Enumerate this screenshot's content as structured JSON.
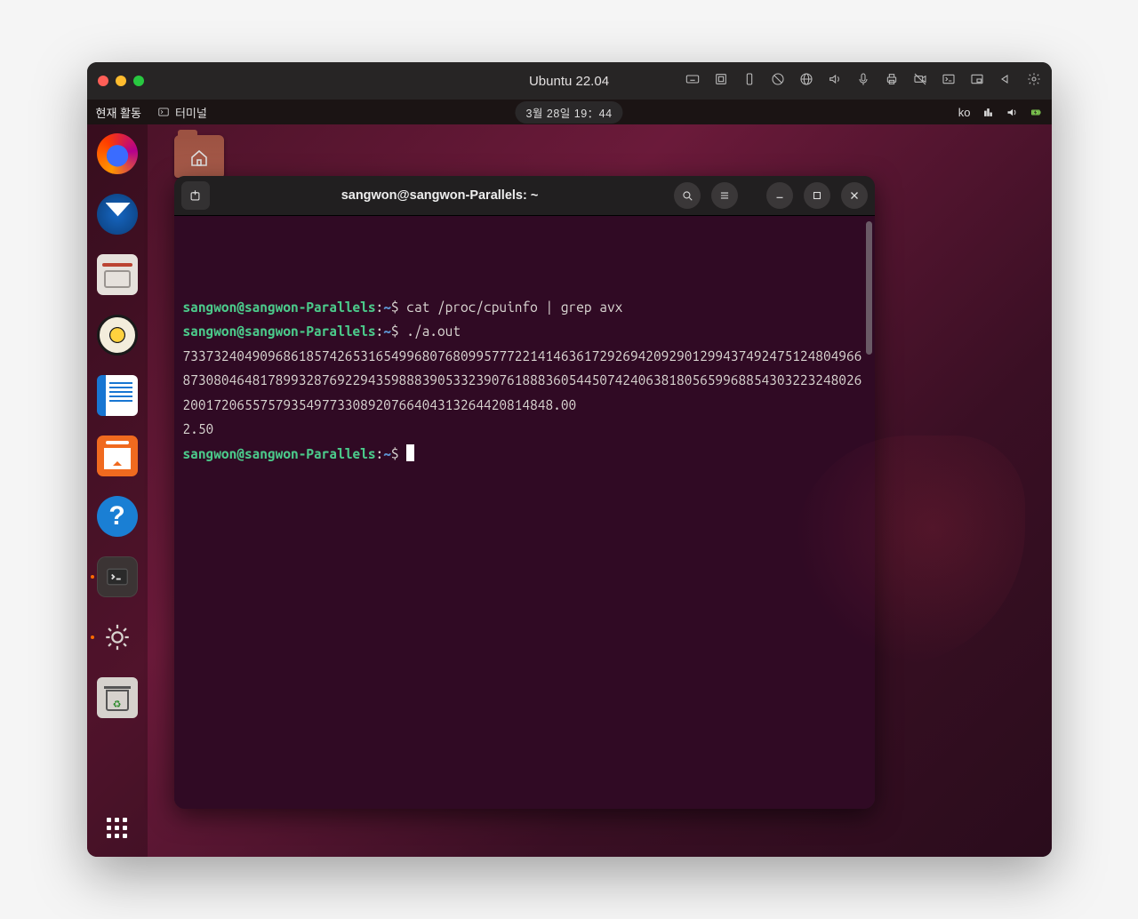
{
  "mac": {
    "title": "Ubuntu 22.04",
    "icons": [
      "keyboard",
      "fullscreen",
      "phone",
      "shield",
      "globe",
      "volume",
      "mic",
      "printer",
      "camera-off",
      "terminal",
      "pip",
      "play",
      "gear"
    ]
  },
  "ubuntu_topbar": {
    "activities": "현재 활동",
    "app_name": "터미널",
    "datetime": "3월 28일  19：44",
    "lang": "ko"
  },
  "dock": {
    "items": [
      "firefox",
      "thunderbird",
      "files",
      "rhythmbox",
      "writer",
      "software",
      "help",
      "terminal",
      "settings",
      "trash"
    ],
    "running": [
      "terminal",
      "settings"
    ]
  },
  "terminal": {
    "title": "sangwon@sangwon-Parallels: ~",
    "prompt_user": "sangwon@sangwon-Parallels",
    "prompt_path": "~",
    "lines": [
      {
        "type": "cmd",
        "command": "cat /proc/cpuinfo | grep avx"
      },
      {
        "type": "cmd",
        "command": "./a.out"
      },
      {
        "type": "out",
        "text": "73373240490968618574265316549968076809957772214146361729269420929012994374924751248049668730804648178993287692294359888390533239076188836054450742406381805659968854303223248026200172065575793549773308920766404313264420814848.00"
      },
      {
        "type": "out",
        "text": "2.50"
      },
      {
        "type": "cmd",
        "command": ""
      }
    ]
  }
}
